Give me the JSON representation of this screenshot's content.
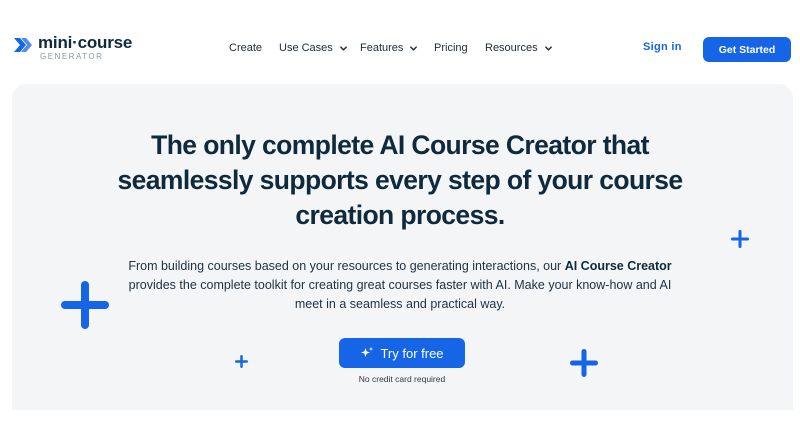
{
  "brand": {
    "name": "mini·course",
    "subtitle": "GENERATOR",
    "accent_color": "#1565e6",
    "text_color": "#0f2a3d"
  },
  "nav": {
    "items": [
      {
        "label": "Create",
        "has_dropdown": false
      },
      {
        "label": "Use Cases",
        "has_dropdown": true
      },
      {
        "label": "Features",
        "has_dropdown": true
      },
      {
        "label": "Pricing",
        "has_dropdown": false
      },
      {
        "label": "Resources",
        "has_dropdown": true
      }
    ],
    "signin_label": "Sign in",
    "cta_label": "Get Started"
  },
  "hero": {
    "headline_line1": "The only complete AI Course Creator that",
    "headline_line2": "seamlessly supports every step of your course",
    "headline_line3": "creation process.",
    "sub_pre": "From building courses based on your resources to generating interactions, our ",
    "sub_bold": "AI Course Creator",
    "sub_line2": "provides the complete toolkit for creating great courses faster with AI. Make your know-how and AI",
    "sub_line3": "meet in a seamless and practical way.",
    "cta_label": "Try for free",
    "cta_icon": "sparkle-icon",
    "note": "No credit card required",
    "background_color": "#f3f5f7",
    "decoration_icon": "plus-icon"
  }
}
